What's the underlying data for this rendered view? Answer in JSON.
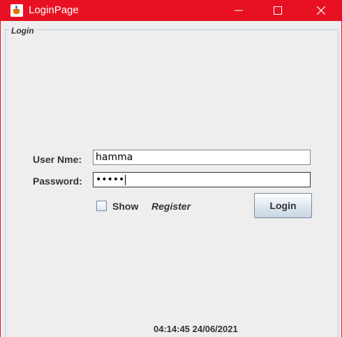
{
  "window": {
    "title": "LoginPage",
    "accent": "#e81123"
  },
  "panel": {
    "legend": "Login"
  },
  "form": {
    "username_label": "User Nme:",
    "username_value": "hamma",
    "password_label": "Password:",
    "password_masked": "•••••",
    "show_label": "Show",
    "show_checked": false,
    "register_label": "Register",
    "login_label": "Login"
  },
  "status": {
    "datetime": "04:14:45 24/06/2021"
  }
}
